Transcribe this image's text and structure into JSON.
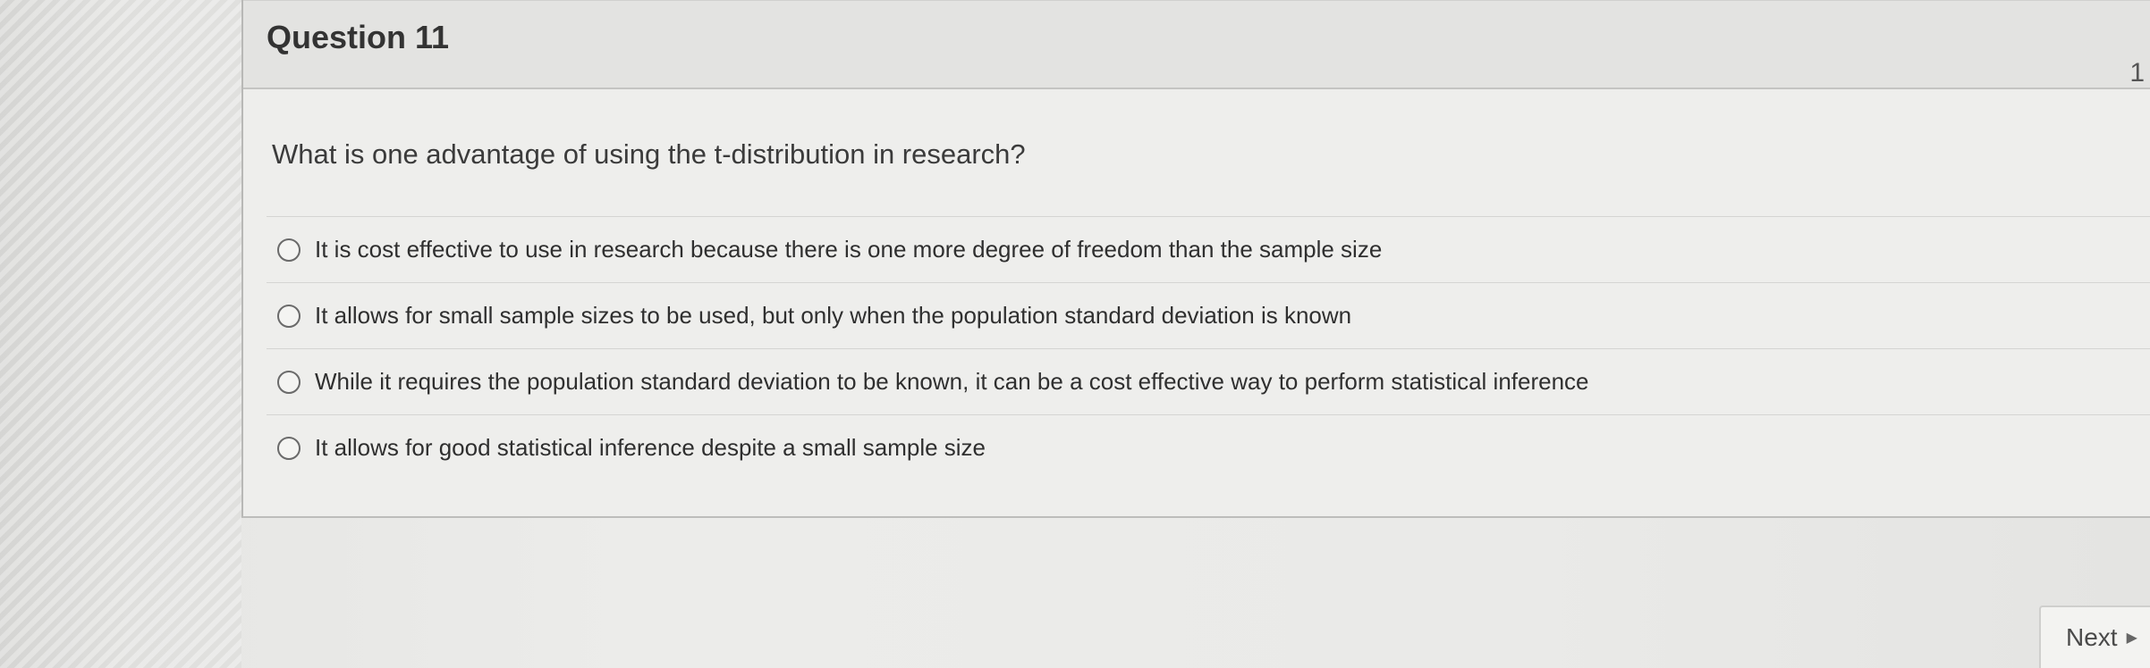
{
  "question": {
    "title": "Question 11",
    "points": "1",
    "text": "What is one advantage of using the t-distribution in research?"
  },
  "answers": [
    {
      "label": "It is cost effective to use in research because there is one more degree of freedom than the sample size"
    },
    {
      "label": "It allows for small sample sizes to be used, but only when the population standard deviation is known"
    },
    {
      "label": "While it requires the population standard deviation to be known, it can be a cost effective way to perform statistical inference"
    },
    {
      "label": "It allows for good statistical inference despite a small sample size"
    }
  ],
  "navigation": {
    "next_label": "Next",
    "next_icon": "play-triangle-icon"
  }
}
